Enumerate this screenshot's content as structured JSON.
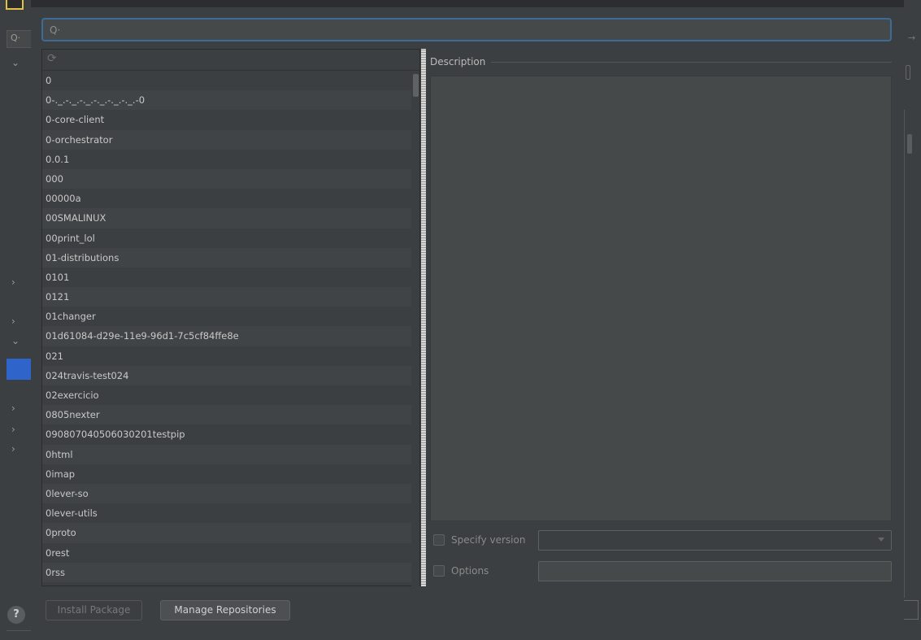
{
  "search": {
    "value": "",
    "placeholder": ""
  },
  "package_list": {
    "items": [
      "0",
      "0-._.-._.-._.-._.-._.-._.-0",
      "0-core-client",
      "0-orchestrator",
      "0.0.1",
      "000",
      "00000a",
      "00SMALINUX",
      "00print_lol",
      "01-distributions",
      "0101",
      "0121",
      "01changer",
      "01d61084-d29e-11e9-96d1-7c5cf84ffe8e",
      "021",
      "024travis-test024",
      "02exercicio",
      "0805nexter",
      "090807040506030201testpip",
      "0html",
      "0imap",
      "0lever-so",
      "0lever-utils",
      "0proto",
      "0rest",
      "0rss"
    ]
  },
  "description": {
    "label": "Description"
  },
  "options": {
    "specify_version_label": "Specify version",
    "options_label": "Options"
  },
  "buttons": {
    "install_package": "Install Package",
    "manage_repositories": "Manage Repositories"
  },
  "colors": {
    "background": "#3c3f41",
    "focus_border": "#3d6a99",
    "selection": "#2f65ca"
  }
}
